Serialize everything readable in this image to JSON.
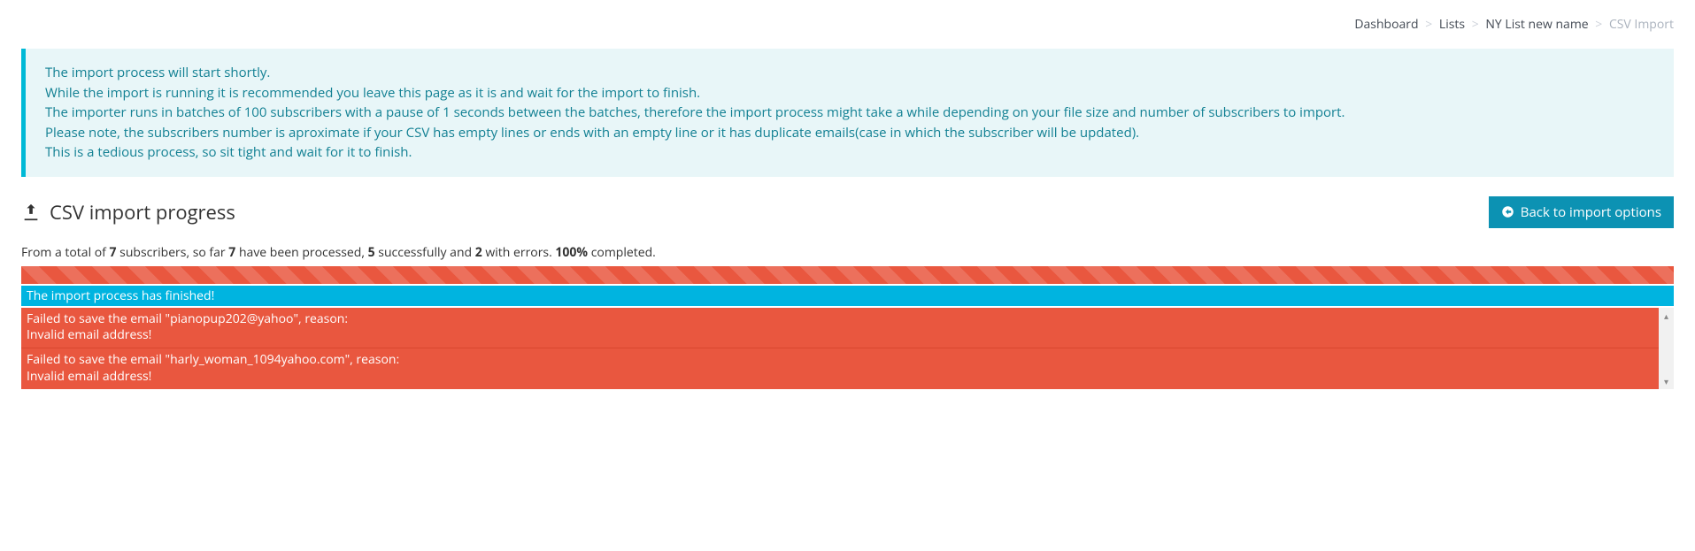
{
  "breadcrumb": {
    "items": [
      {
        "label": "Dashboard"
      },
      {
        "label": "Lists"
      },
      {
        "label": "NY List new name"
      }
    ],
    "current": "CSV Import",
    "sep": ">"
  },
  "info": {
    "l1": "The import process will start shortly.",
    "l2": "While the import is running it is recommended you leave this page as it is and wait for the import to finish.",
    "l3": "The importer runs in batches of 100 subscribers with a pause of 1 seconds between the batches, therefore the import process might take a while depending on your file size and number of subscribers to import.",
    "l4": "Please note, the subscribers number is aproximate if your CSV has empty lines or ends with an empty line or it has duplicate emails(case in which the subscriber will be updated).",
    "l5": "This is a tedious process, so sit tight and wait for it to finish."
  },
  "heading": "CSV import progress",
  "back_button": "Back to import options",
  "status": {
    "t1": "From a total of ",
    "total": "7",
    "t2": " subscribers, so far ",
    "processed": "7",
    "t3": " have been processed, ",
    "success": "5",
    "t4": " successfully and ",
    "errors_count": "2",
    "t5": " with errors. ",
    "percent": "100%",
    "t6": " completed."
  },
  "progress_width": "100%",
  "finish_message": "The import process has finished!",
  "errors": [
    {
      "line1": "Failed to save the email \"pianopup202@yahoo\", reason:",
      "line2": "Invalid email address!"
    },
    {
      "line1": "Failed to save the email \"harly_woman_1094yahoo.com\", reason:",
      "line2": "Invalid email address!"
    }
  ]
}
